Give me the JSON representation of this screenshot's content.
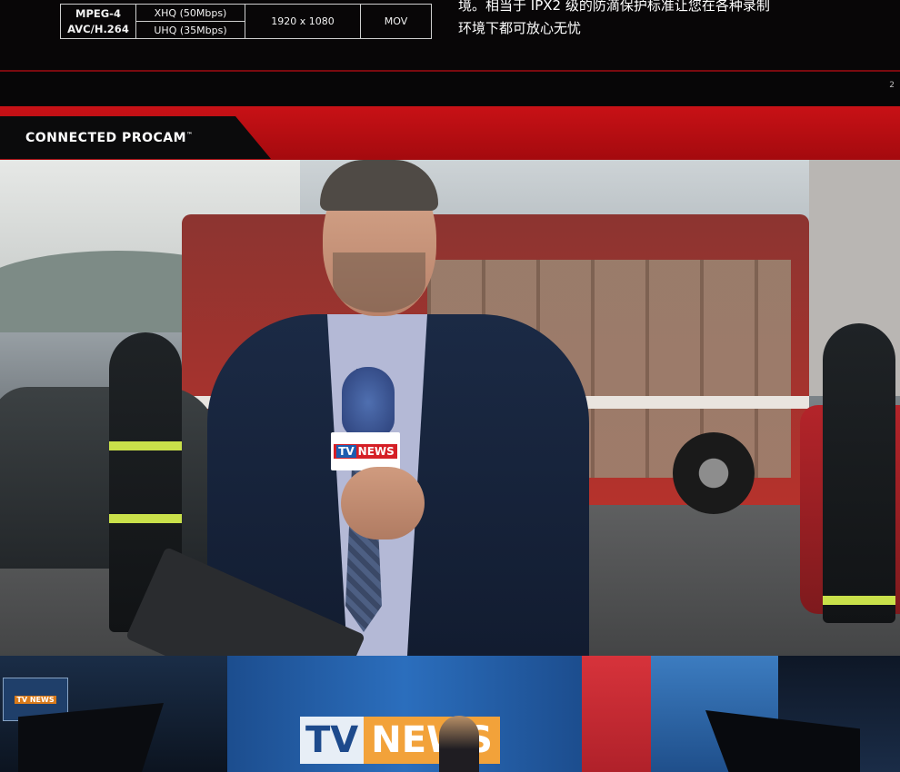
{
  "spec_table": {
    "codec_line1": "MPEG-4",
    "codec_line2": "AVC/H.264",
    "rate_1": "XHQ (50Mbps)",
    "rate_2": "UHQ (35Mbps)",
    "resolution": "1920 x 1080",
    "format": "MOV"
  },
  "description": {
    "line1": "境。相当于 IPX2 级的防滴保护标准让您在各种录制",
    "line2": "环境下都可放心无忧"
  },
  "page_number": "2",
  "section_band": {
    "title": "CONNECTED PROCAM",
    "trademark": "™"
  },
  "photo": {
    "mic_flag_tv": "TV",
    "mic_flag_news": "NEWS"
  },
  "studio": {
    "monitor_label": "TV NEWS",
    "logo_tv": "TV",
    "logo_news": "NEWS"
  },
  "colors": {
    "band_red": "#c81116",
    "page_bg": "#070607",
    "accent_line": "#7a0a0f"
  }
}
